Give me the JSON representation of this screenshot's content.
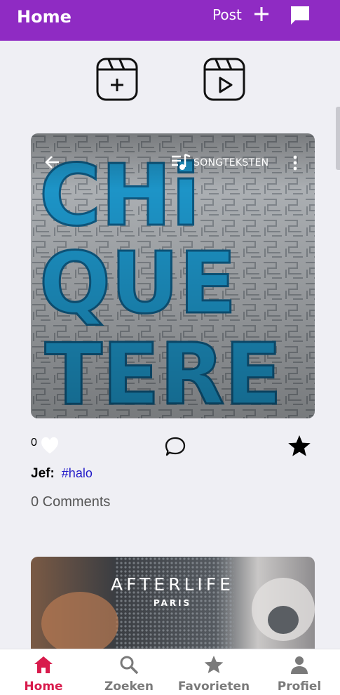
{
  "header": {
    "title": "Home",
    "post_label": "Post"
  },
  "posts": [
    {
      "media": {
        "artwork_text": "CHIQUETERE",
        "lyrics_label": "SONGTEKSTEN"
      },
      "like_count": "0",
      "author": "Jef:",
      "hashtag": "#halo",
      "comments_label": "0 Comments"
    },
    {
      "media": {
        "title": "AFTERLIFE",
        "subtitle": "PARIS"
      }
    }
  ],
  "nav": {
    "items": [
      {
        "label": "Home",
        "icon": "home-icon",
        "active": true
      },
      {
        "label": "Zoeken",
        "icon": "search-icon"
      },
      {
        "label": "Favorieten",
        "icon": "star-icon"
      },
      {
        "label": "Profiel",
        "icon": "person-icon"
      }
    ]
  },
  "colors": {
    "appbar": "#8f2bc3",
    "accent_active": "#d81b4c",
    "hashtag": "#1f17c8",
    "background": "#efeff4"
  }
}
